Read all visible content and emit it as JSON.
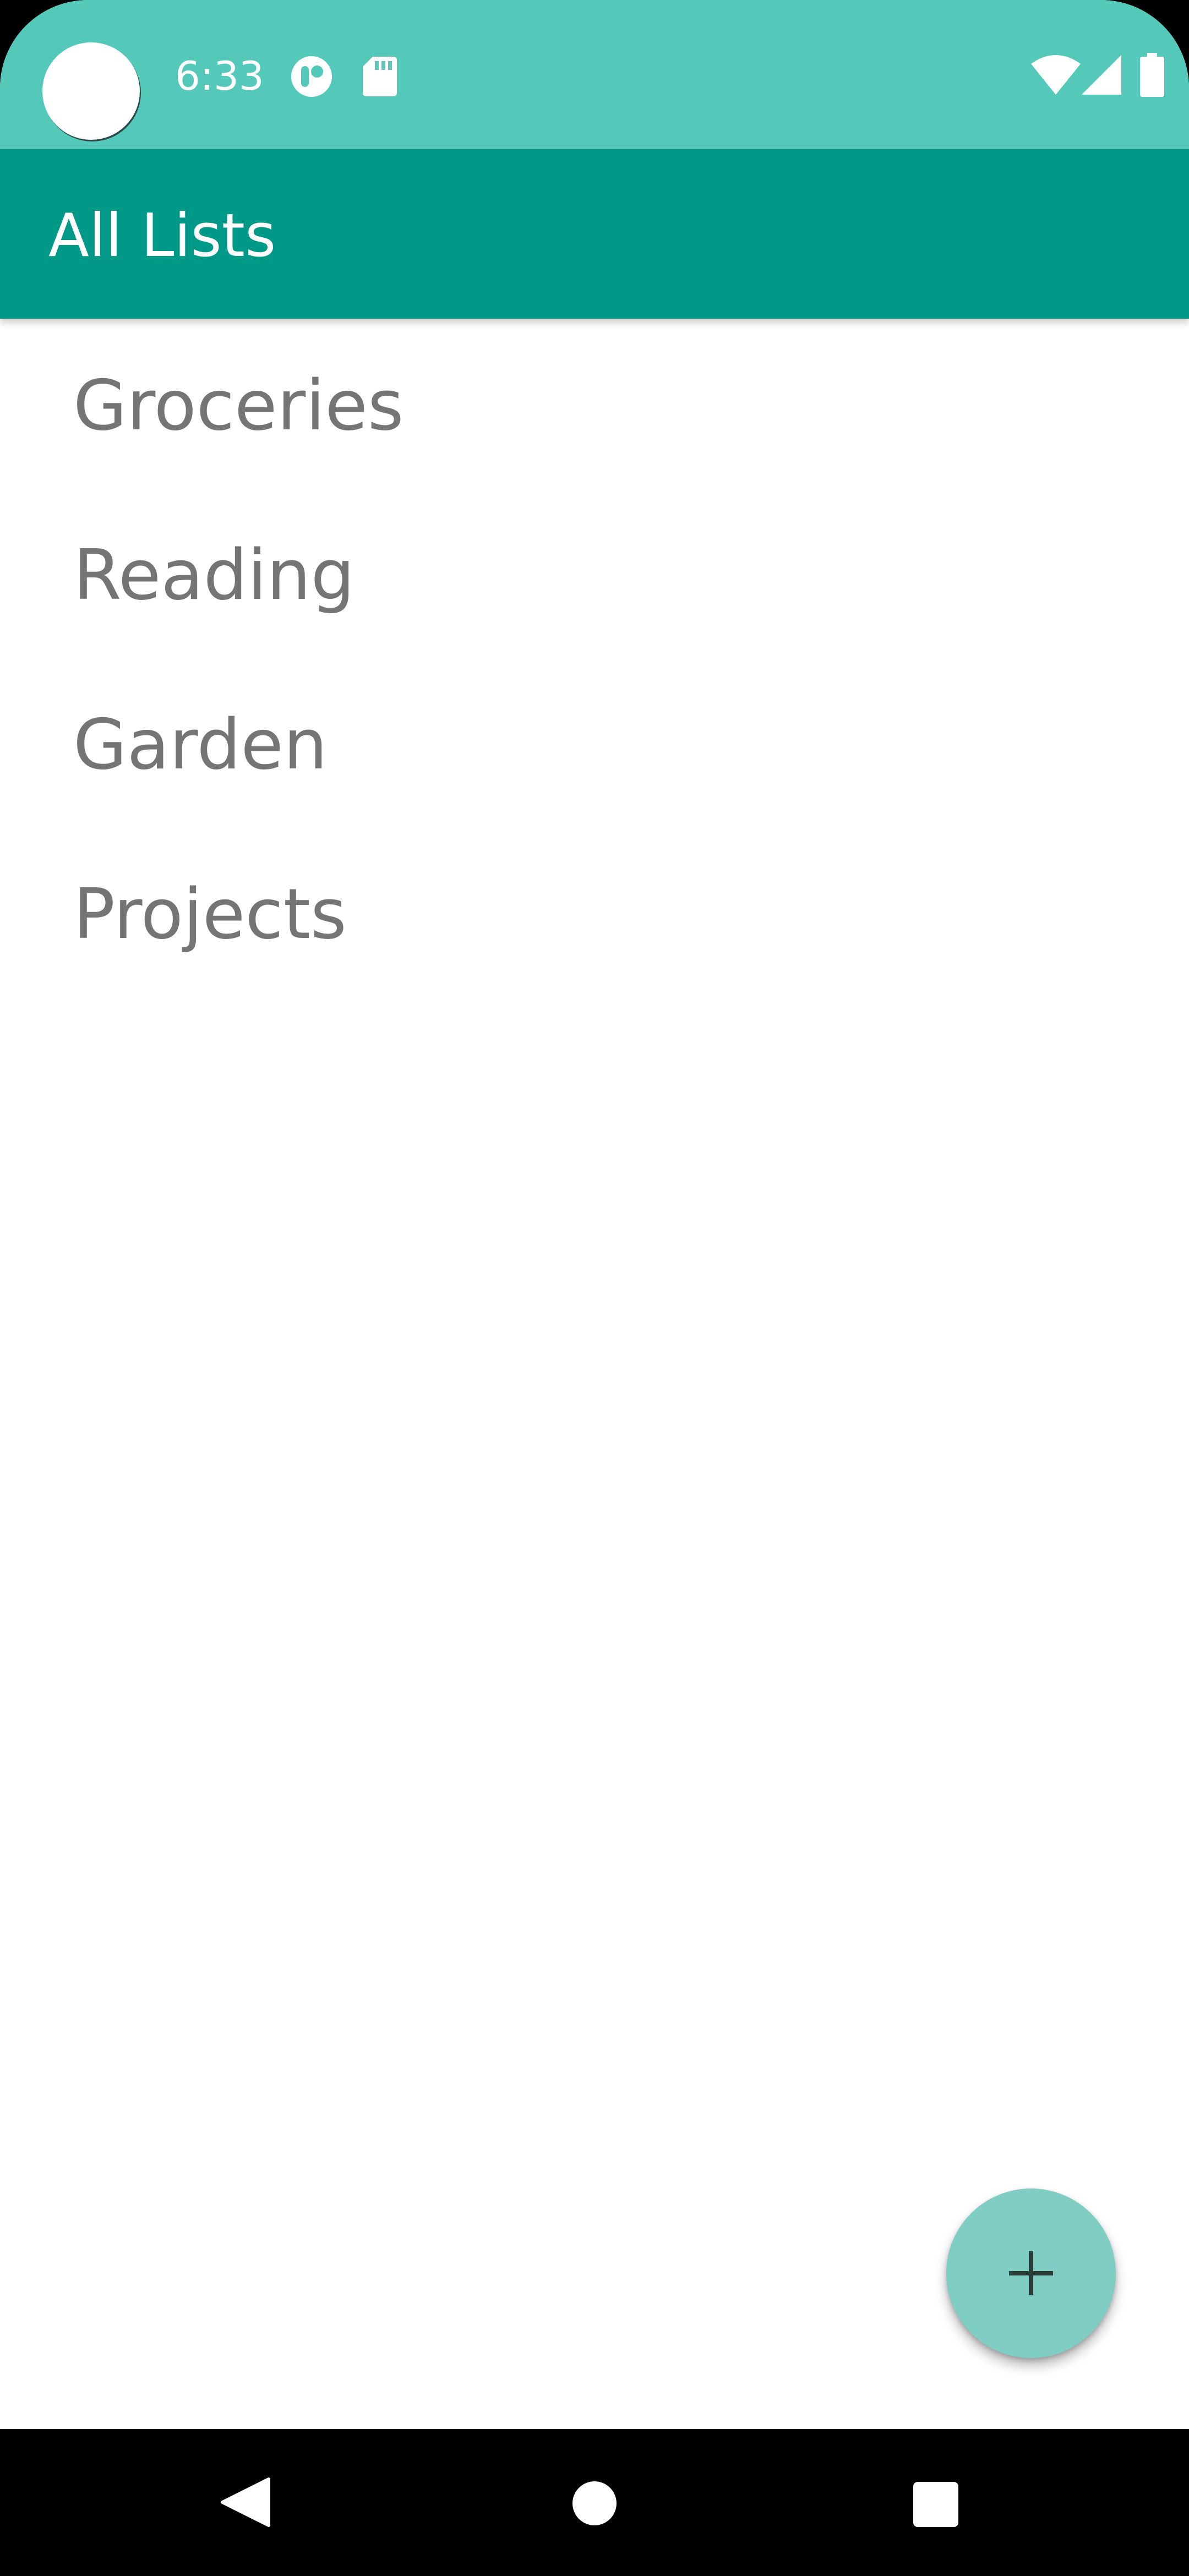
{
  "status_bar": {
    "time": "6:33",
    "left_icons": [
      "camera-cutout",
      "notification-app-icon",
      "sd-card-icon"
    ],
    "right_icons": [
      "wifi-icon",
      "cellular-signal-icon",
      "battery-icon"
    ]
  },
  "app_bar": {
    "title": "All Lists"
  },
  "lists": {
    "items": [
      {
        "label": "Groceries"
      },
      {
        "label": "Reading"
      },
      {
        "label": "Garden"
      },
      {
        "label": "Projects"
      }
    ]
  },
  "fab": {
    "icon": "plus-icon"
  },
  "nav_bar": {
    "buttons": [
      "back-icon",
      "home-icon",
      "recents-icon"
    ]
  },
  "colors": {
    "status_bar": "#55c9b9",
    "app_bar": "#009886",
    "fab": "#80cdc3",
    "list_text": "#757575"
  }
}
